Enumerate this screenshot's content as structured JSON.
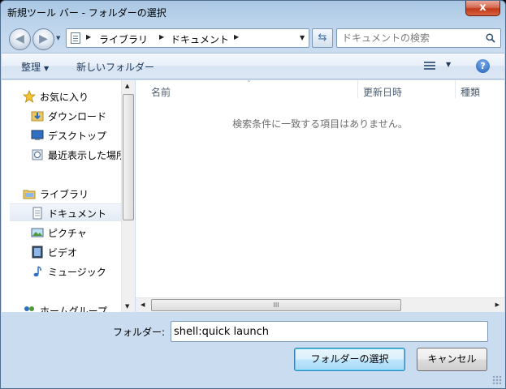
{
  "window": {
    "title": "新規ツール バー - フォルダーの選択",
    "close_glyph": "x"
  },
  "nav": {
    "back_glyph": "◀",
    "forward_glyph": "▶",
    "dropdown_glyph": "▼"
  },
  "address": {
    "crumbs": [
      "ライブラリ",
      "ドキュメント"
    ],
    "arrow_glyph": "▶",
    "dropdown_glyph": "▼",
    "refresh_glyph": "⇆"
  },
  "search": {
    "placeholder": "ドキュメントの検索"
  },
  "toolbar": {
    "organize_label": "整理",
    "organize_caret": "▼",
    "new_folder_label": "新しいフォルダー",
    "view_caret": "▼",
    "help_glyph": "?"
  },
  "sidebar": {
    "items": [
      {
        "label": "お気に入り",
        "icon": "favorites-star-icon"
      },
      {
        "label": "ダウンロード",
        "icon": "downloads-folder-icon"
      },
      {
        "label": "デスクトップ",
        "icon": "desktop-icon"
      },
      {
        "label": "最近表示した場所",
        "icon": "recent-places-icon"
      },
      {
        "label": "ライブラリ",
        "icon": "library-folder-icon"
      },
      {
        "label": "ドキュメント",
        "icon": "document-icon",
        "selected": true
      },
      {
        "label": "ピクチャ",
        "icon": "pictures-icon"
      },
      {
        "label": "ビデオ",
        "icon": "video-icon"
      },
      {
        "label": "ミュージック",
        "icon": "music-note-icon"
      },
      {
        "label": "ホームグループ",
        "icon": "homegroup-icon"
      }
    ]
  },
  "file_list": {
    "columns": [
      "名前",
      "更新日時",
      "種類"
    ],
    "sort_glyph": "^",
    "empty_message": "検索条件に一致する項目はありません。"
  },
  "scrollbars": {
    "up_glyph": "▲",
    "down_glyph": "▼",
    "left_glyph": "◀",
    "right_glyph": "▶",
    "thumb_grip": "III"
  },
  "footer": {
    "folder_label": "フォルダー:",
    "folder_value": "shell:quick launch",
    "select_button": "フォルダーの選択",
    "cancel_button": "キャンセル"
  },
  "colors": {
    "accent": "#3c7fb1",
    "selection": "#e3ebf5"
  }
}
